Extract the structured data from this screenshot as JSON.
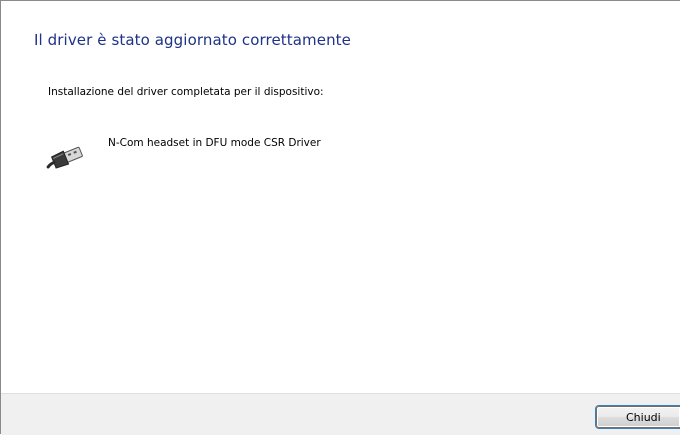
{
  "dialog": {
    "heading": "Il driver è stato aggiornato correttamente",
    "message": "Installazione del driver completata per il dispositivo:",
    "device": {
      "icon": "usb-plug-icon",
      "name": "N-Com headset in DFU mode CSR Driver"
    }
  },
  "footer": {
    "close_label": "Chiudi"
  },
  "colors": {
    "heading": "#1e3287",
    "footer_background": "#f0f0f0",
    "button_focus_border": "#3c7fb1"
  }
}
